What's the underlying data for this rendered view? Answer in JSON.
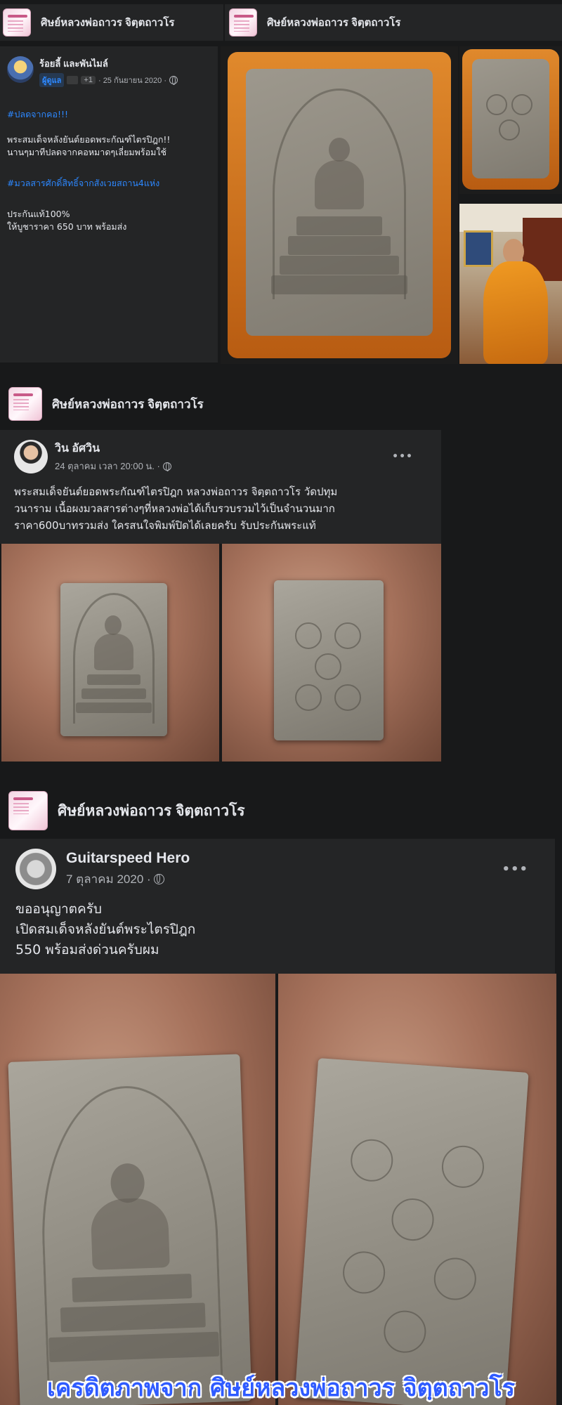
{
  "group_name": "ศิษย์หลวงพ่อถาวร จิตฺตถาวโร",
  "post1": {
    "author": "ร้อยลี้ และพันไมล์",
    "badge": "ผู้ดูแล",
    "plus": "+1",
    "date": "· 25 กันยายน 2020 ·",
    "hashtag1": "#ปลดจากคอ!!!",
    "body": "พระสมเด็จหลังยันต์ยอดพระกัณฑ์ไตรปิฎก!!\nนานๆมาทีปลดจากคอหมาดๆเลี่ยมพร้อมใช้",
    "hashtag2": "#มวลสารศักดิ์สิทธิ์จากสังเวยสถาน4แห่ง",
    "body2": "ประกันแท้100%\nให้บูชาราคา 650 บาท พร้อมส่ง"
  },
  "post2": {
    "author": "วิน อัศวิน",
    "date": "24 ตุลาคม เวลา 20:00 น. ·",
    "body": "พระสมเด็จยันต์ยอดพระกัณฑ์ไตรปิฎก หลวงพ่อถาวร จิตฺตถาวโร วัดปทุม\nวนาราม เนื้อผงมวลสารต่างๆที่หลวงพ่อได้เก็บรวบรวมไว้เป็นจำนวนมาก\nราคา600บาทรวมส่ง ใครสนใจพิมพ์ปิดได้เลยครับ รับประกันพระแท้"
  },
  "post3": {
    "author": "Guitarspeed Hero",
    "date": "7 ตุลาคม 2020 ·",
    "body": "ขออนุญาตครับ\nเปิดสมเด็จหลังยันต์พระไตรปิฎก\n550 พร้อมส่งด่วนครับผม"
  },
  "more_label": "•••",
  "credit": "เครดิตภาพจาก ศิษย์หลวงพ่อถาวร จิตฺตถาวโร"
}
